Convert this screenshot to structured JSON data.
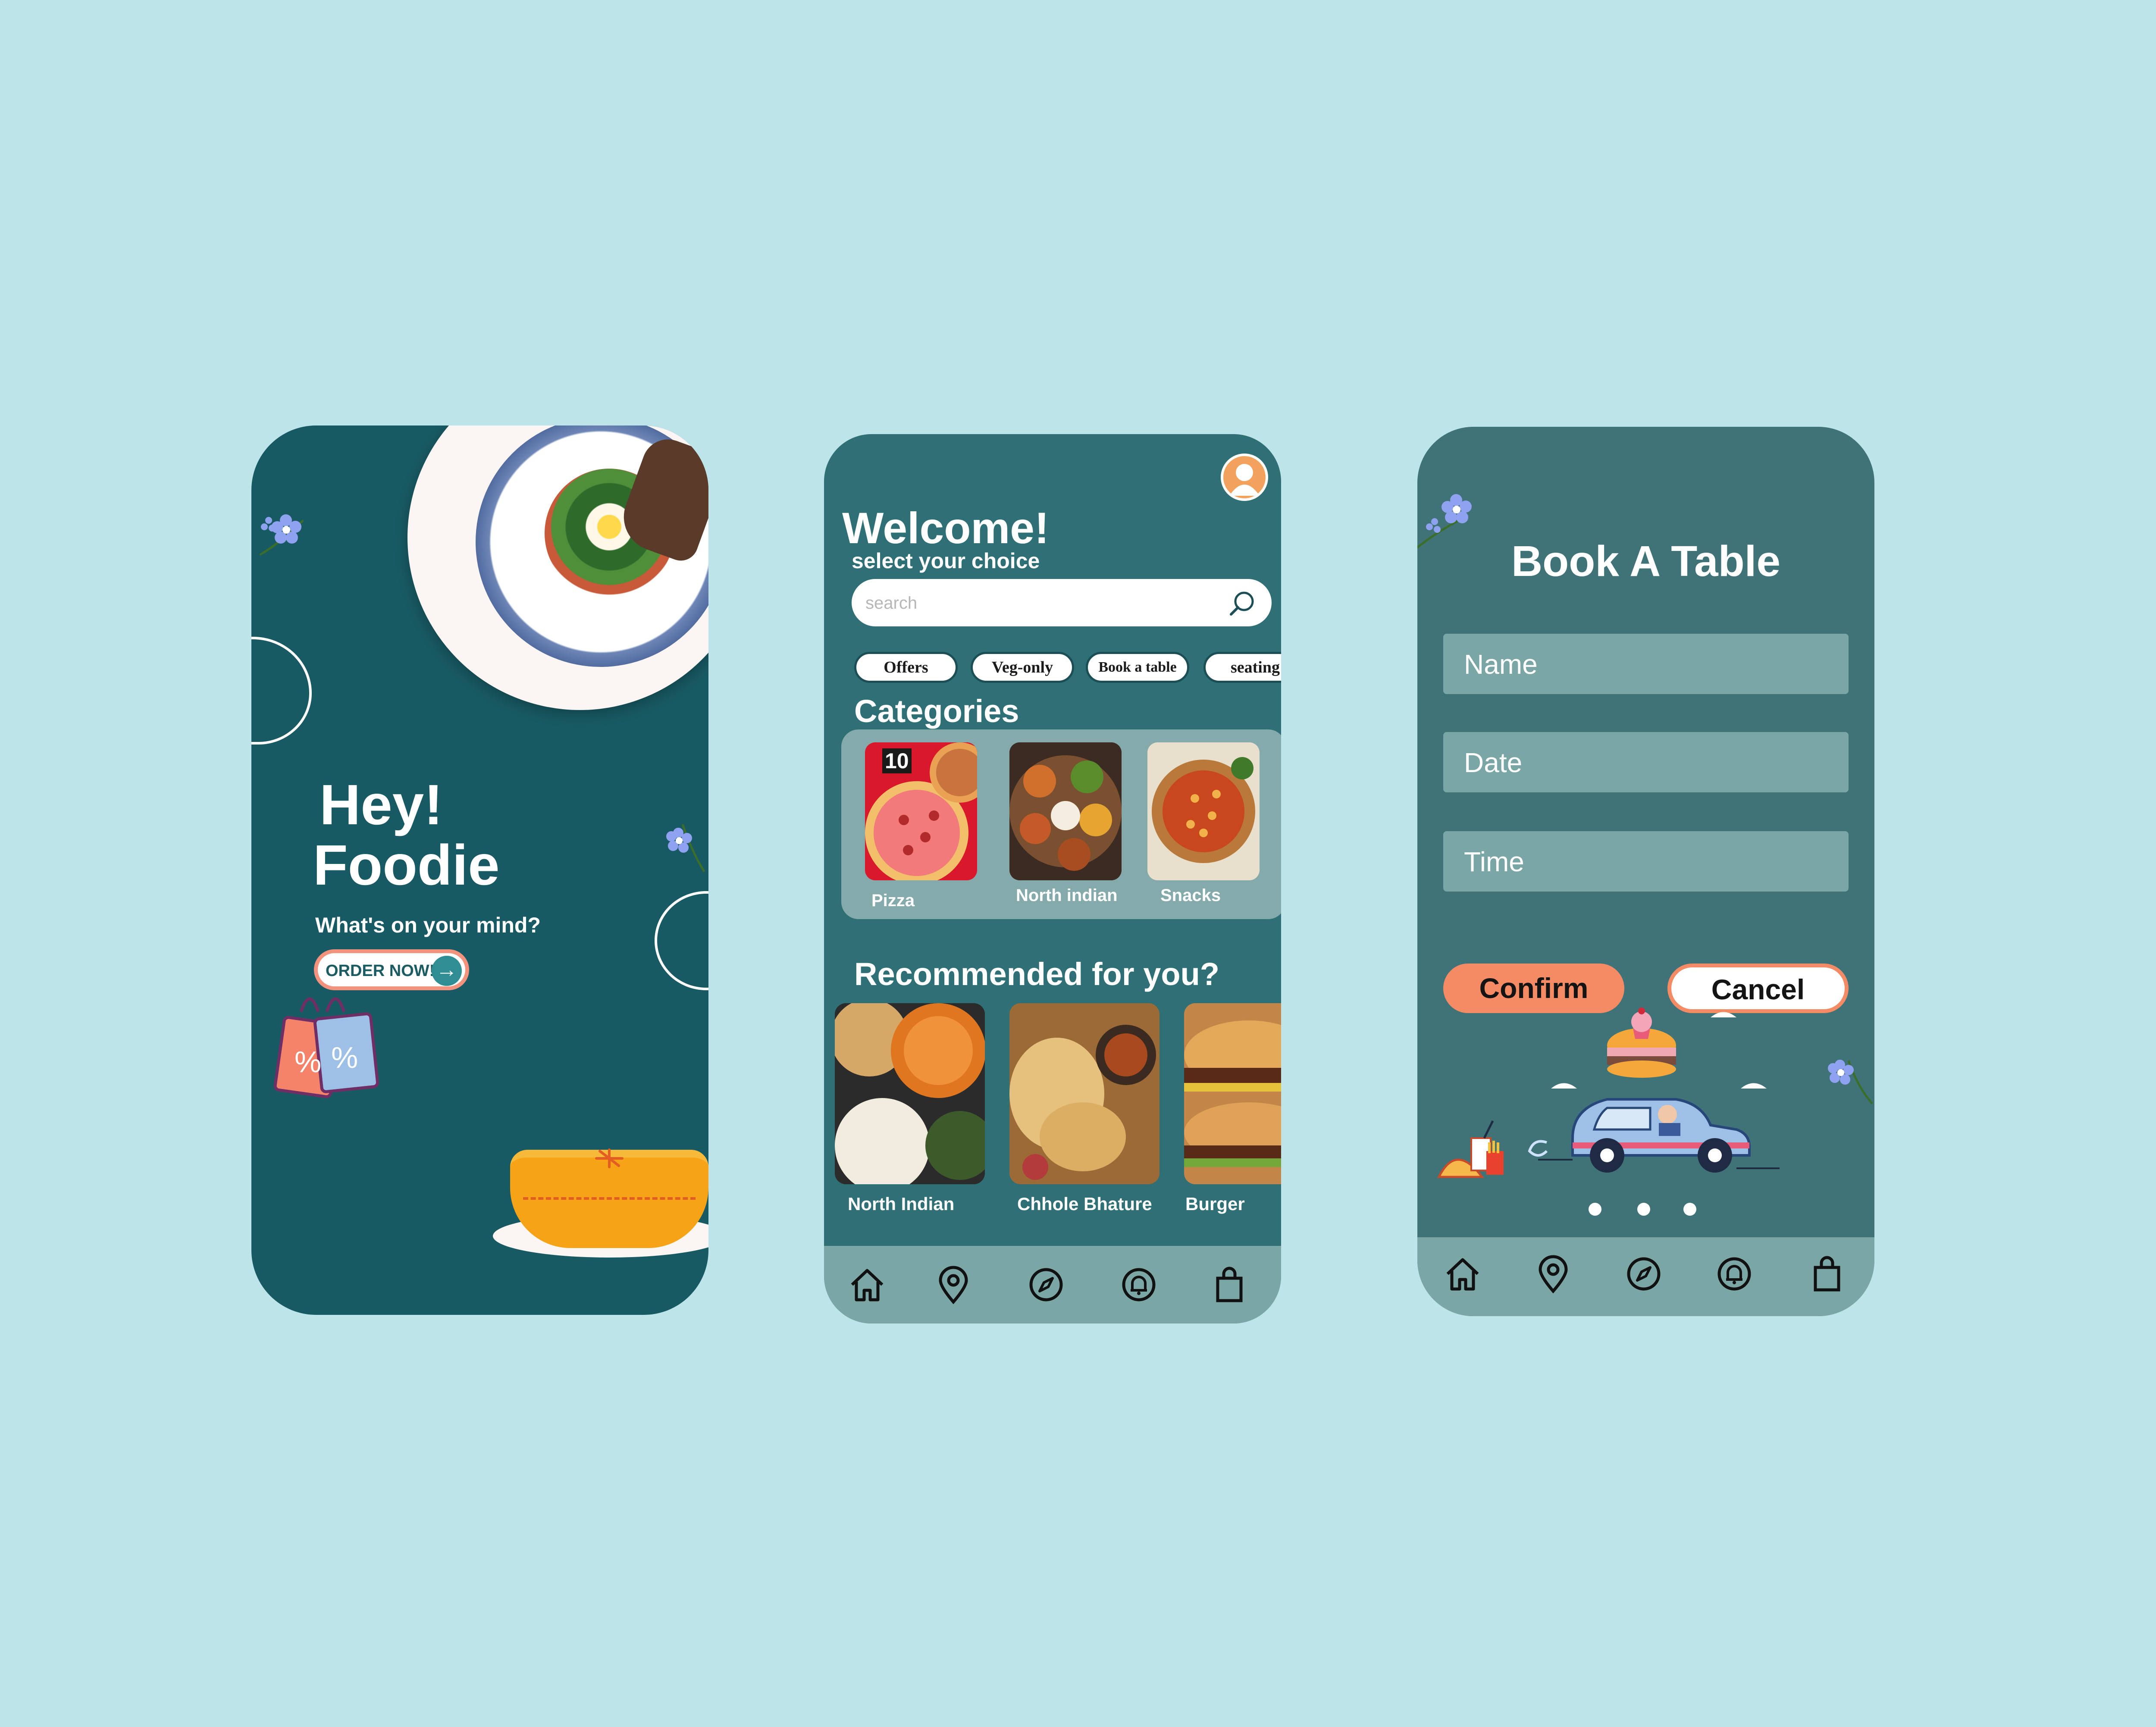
{
  "screen1": {
    "title_line1": "Hey!",
    "title_line2": "Foodie",
    "subtitle": "What's on your mind?",
    "order_button": "ORDER NOW!",
    "arrow_glyph": "→",
    "accent_color": "#f3937d"
  },
  "screen2": {
    "welcome": "Welcome!",
    "subtitle": "select your choice",
    "search": {
      "placeholder": "search"
    },
    "chips": [
      "Offers",
      "Veg-only",
      "Book a table",
      "seating"
    ],
    "categories_title": "Categories",
    "categories": [
      {
        "label": "Pizza",
        "image": "pizza",
        "badge": "10"
      },
      {
        "label": "North indian",
        "image": "north-indian-thali"
      },
      {
        "label": "Snacks",
        "image": "snacks-bowl"
      }
    ],
    "recommended_title": "Recommended for you?",
    "recommended": [
      {
        "label": "North Indian",
        "image": "north-indian-spread"
      },
      {
        "label": "Chhole Bhature",
        "image": "chhole-bhature"
      },
      {
        "label": "Burger",
        "image": "burger"
      }
    ],
    "nav": [
      "home-icon",
      "location-icon",
      "compass-icon",
      "bell-icon",
      "bag-icon"
    ]
  },
  "screen3": {
    "title": "Book A Table",
    "fields": [
      {
        "placeholder": "Name"
      },
      {
        "placeholder": "Date"
      },
      {
        "placeholder": "Time"
      }
    ],
    "confirm": "Confirm",
    "cancel": "Cancel",
    "nav": [
      "home-icon",
      "location-icon",
      "compass-icon",
      "bell-icon",
      "bag-icon"
    ],
    "confirm_color": "#f58b64"
  },
  "colors": {
    "background": "#bce4e9",
    "phone1": "#185a63",
    "phone2": "#2f6f76",
    "phone3": "#3f7377",
    "navbar": "#7aa7a6"
  }
}
